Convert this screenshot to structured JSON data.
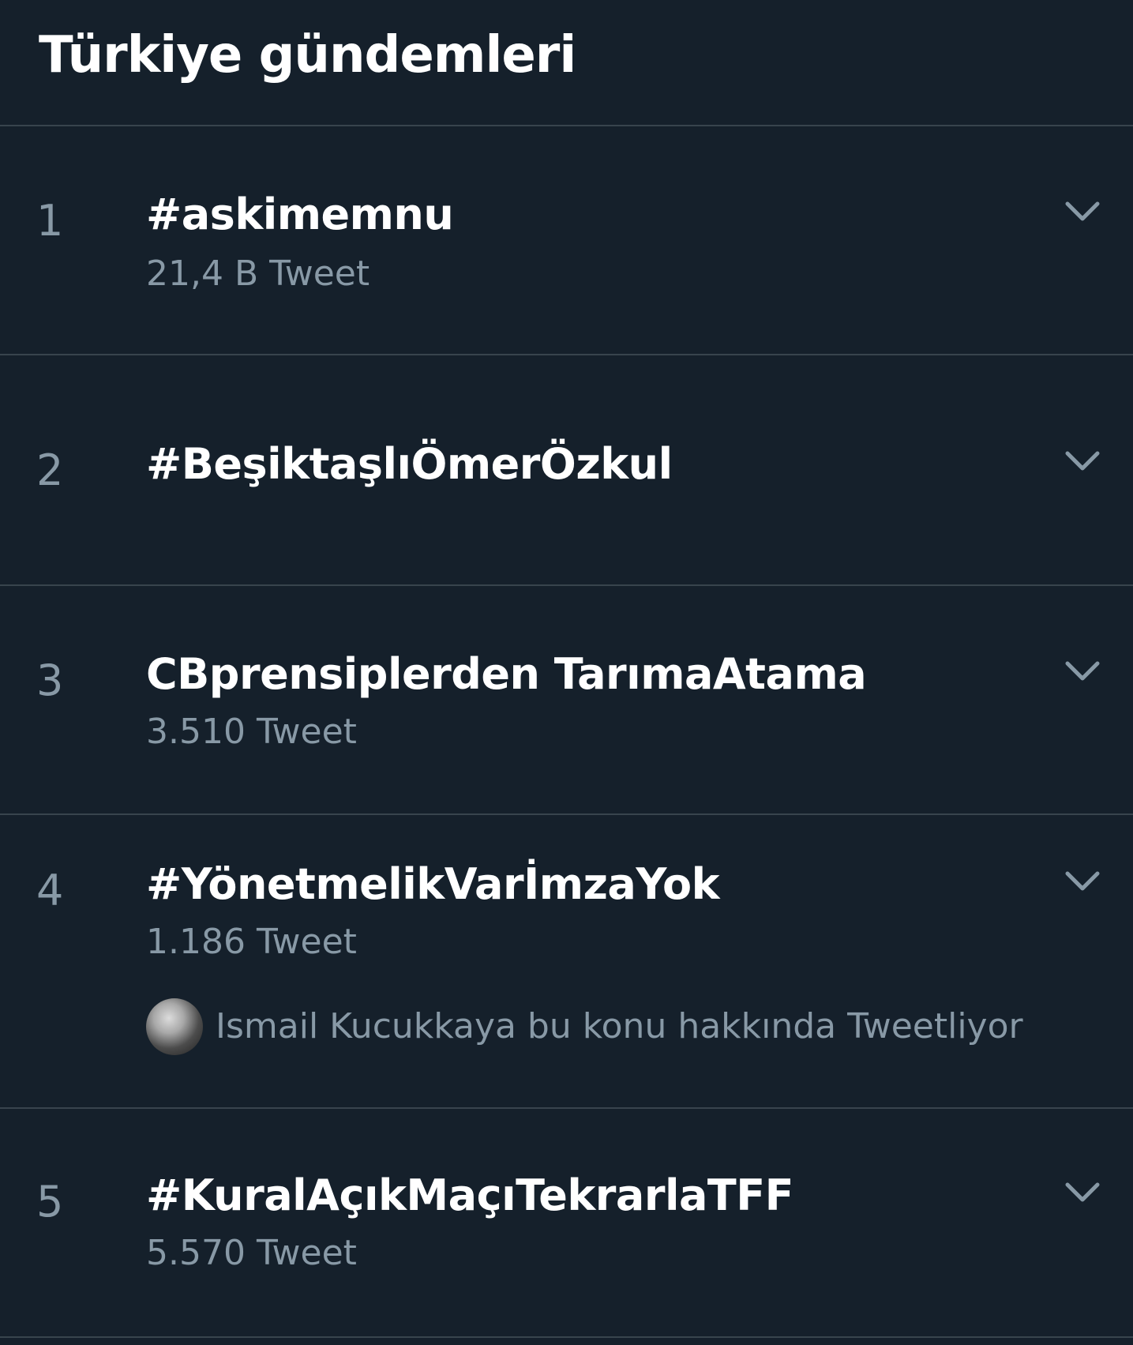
{
  "header": {
    "title": "Türkiye gündemleri"
  },
  "trends": [
    {
      "rank": "1",
      "name": "#askimemnu",
      "count": "21,4 B Tweet"
    },
    {
      "rank": "2",
      "name": "#BeşiktaşlıÖmerÖzkul"
    },
    {
      "rank": "3",
      "name": "CBprensiplerden TarımaAtama",
      "count": "3.510 Tweet"
    },
    {
      "rank": "4",
      "name": "#YönetmelikVarİmzaYok",
      "count": "1.186 Tweet",
      "context": "Ismail Kucukkaya bu konu hakkında Tweetliyor"
    },
    {
      "rank": "5",
      "name": "#KuralAçıkMaçıTekrarlaTFF",
      "count": "5.570 Tweet"
    }
  ],
  "icons": {
    "chevron": "chevron-down-icon",
    "avatar": "avatar"
  },
  "colors": {
    "background": "#15202b",
    "divider": "#38444d",
    "secondary_text": "#8899a6",
    "primary_text": "#ffffff"
  }
}
